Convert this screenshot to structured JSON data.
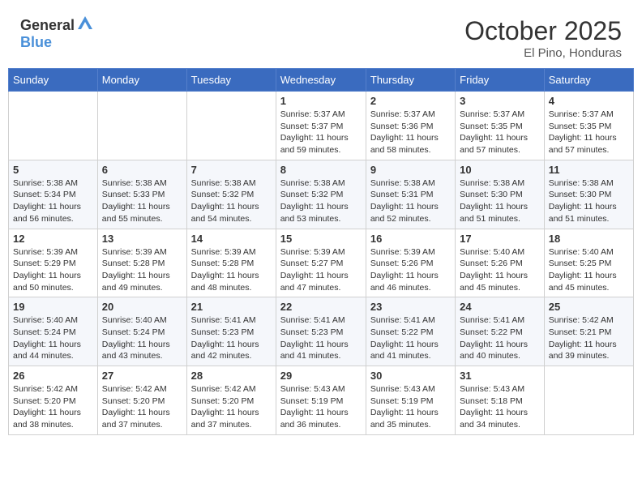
{
  "header": {
    "logo_general": "General",
    "logo_blue": "Blue",
    "month": "October 2025",
    "location": "El Pino, Honduras"
  },
  "calendar": {
    "weekdays": [
      "Sunday",
      "Monday",
      "Tuesday",
      "Wednesday",
      "Thursday",
      "Friday",
      "Saturday"
    ],
    "weeks": [
      [
        {
          "day": "",
          "info": ""
        },
        {
          "day": "",
          "info": ""
        },
        {
          "day": "",
          "info": ""
        },
        {
          "day": "1",
          "info": "Sunrise: 5:37 AM\nSunset: 5:37 PM\nDaylight: 11 hours\nand 59 minutes."
        },
        {
          "day": "2",
          "info": "Sunrise: 5:37 AM\nSunset: 5:36 PM\nDaylight: 11 hours\nand 58 minutes."
        },
        {
          "day": "3",
          "info": "Sunrise: 5:37 AM\nSunset: 5:35 PM\nDaylight: 11 hours\nand 57 minutes."
        },
        {
          "day": "4",
          "info": "Sunrise: 5:37 AM\nSunset: 5:35 PM\nDaylight: 11 hours\nand 57 minutes."
        }
      ],
      [
        {
          "day": "5",
          "info": "Sunrise: 5:38 AM\nSunset: 5:34 PM\nDaylight: 11 hours\nand 56 minutes."
        },
        {
          "day": "6",
          "info": "Sunrise: 5:38 AM\nSunset: 5:33 PM\nDaylight: 11 hours\nand 55 minutes."
        },
        {
          "day": "7",
          "info": "Sunrise: 5:38 AM\nSunset: 5:32 PM\nDaylight: 11 hours\nand 54 minutes."
        },
        {
          "day": "8",
          "info": "Sunrise: 5:38 AM\nSunset: 5:32 PM\nDaylight: 11 hours\nand 53 minutes."
        },
        {
          "day": "9",
          "info": "Sunrise: 5:38 AM\nSunset: 5:31 PM\nDaylight: 11 hours\nand 52 minutes."
        },
        {
          "day": "10",
          "info": "Sunrise: 5:38 AM\nSunset: 5:30 PM\nDaylight: 11 hours\nand 51 minutes."
        },
        {
          "day": "11",
          "info": "Sunrise: 5:38 AM\nSunset: 5:30 PM\nDaylight: 11 hours\nand 51 minutes."
        }
      ],
      [
        {
          "day": "12",
          "info": "Sunrise: 5:39 AM\nSunset: 5:29 PM\nDaylight: 11 hours\nand 50 minutes."
        },
        {
          "day": "13",
          "info": "Sunrise: 5:39 AM\nSunset: 5:28 PM\nDaylight: 11 hours\nand 49 minutes."
        },
        {
          "day": "14",
          "info": "Sunrise: 5:39 AM\nSunset: 5:28 PM\nDaylight: 11 hours\nand 48 minutes."
        },
        {
          "day": "15",
          "info": "Sunrise: 5:39 AM\nSunset: 5:27 PM\nDaylight: 11 hours\nand 47 minutes."
        },
        {
          "day": "16",
          "info": "Sunrise: 5:39 AM\nSunset: 5:26 PM\nDaylight: 11 hours\nand 46 minutes."
        },
        {
          "day": "17",
          "info": "Sunrise: 5:40 AM\nSunset: 5:26 PM\nDaylight: 11 hours\nand 45 minutes."
        },
        {
          "day": "18",
          "info": "Sunrise: 5:40 AM\nSunset: 5:25 PM\nDaylight: 11 hours\nand 45 minutes."
        }
      ],
      [
        {
          "day": "19",
          "info": "Sunrise: 5:40 AM\nSunset: 5:24 PM\nDaylight: 11 hours\nand 44 minutes."
        },
        {
          "day": "20",
          "info": "Sunrise: 5:40 AM\nSunset: 5:24 PM\nDaylight: 11 hours\nand 43 minutes."
        },
        {
          "day": "21",
          "info": "Sunrise: 5:41 AM\nSunset: 5:23 PM\nDaylight: 11 hours\nand 42 minutes."
        },
        {
          "day": "22",
          "info": "Sunrise: 5:41 AM\nSunset: 5:23 PM\nDaylight: 11 hours\nand 41 minutes."
        },
        {
          "day": "23",
          "info": "Sunrise: 5:41 AM\nSunset: 5:22 PM\nDaylight: 11 hours\nand 41 minutes."
        },
        {
          "day": "24",
          "info": "Sunrise: 5:41 AM\nSunset: 5:22 PM\nDaylight: 11 hours\nand 40 minutes."
        },
        {
          "day": "25",
          "info": "Sunrise: 5:42 AM\nSunset: 5:21 PM\nDaylight: 11 hours\nand 39 minutes."
        }
      ],
      [
        {
          "day": "26",
          "info": "Sunrise: 5:42 AM\nSunset: 5:20 PM\nDaylight: 11 hours\nand 38 minutes."
        },
        {
          "day": "27",
          "info": "Sunrise: 5:42 AM\nSunset: 5:20 PM\nDaylight: 11 hours\nand 37 minutes."
        },
        {
          "day": "28",
          "info": "Sunrise: 5:42 AM\nSunset: 5:20 PM\nDaylight: 11 hours\nand 37 minutes."
        },
        {
          "day": "29",
          "info": "Sunrise: 5:43 AM\nSunset: 5:19 PM\nDaylight: 11 hours\nand 36 minutes."
        },
        {
          "day": "30",
          "info": "Sunrise: 5:43 AM\nSunset: 5:19 PM\nDaylight: 11 hours\nand 35 minutes."
        },
        {
          "day": "31",
          "info": "Sunrise: 5:43 AM\nSunset: 5:18 PM\nDaylight: 11 hours\nand 34 minutes."
        },
        {
          "day": "",
          "info": ""
        }
      ]
    ]
  }
}
